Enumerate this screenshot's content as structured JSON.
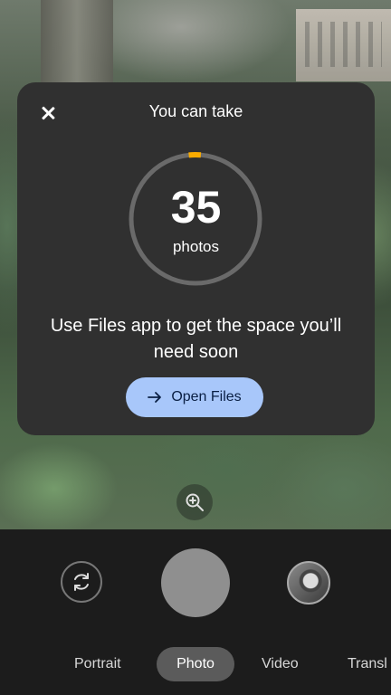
{
  "dialog": {
    "title": "You can take",
    "count": "35",
    "count_unit": "photos",
    "message": "Use Files app to get the space you’ll need soon",
    "button_label": "Open Files",
    "progress_fraction": 0.03,
    "colors": {
      "dialog_bg": "#303030",
      "button_bg": "#a8c7fa",
      "progress": "#f9ab00"
    }
  },
  "camera": {
    "modes": [
      "Portrait",
      "Photo",
      "Video",
      "Transl"
    ],
    "active_mode": "Photo"
  },
  "icons": [
    "close-icon",
    "arrow-right-icon",
    "zoom-icon",
    "switch-camera-icon"
  ]
}
